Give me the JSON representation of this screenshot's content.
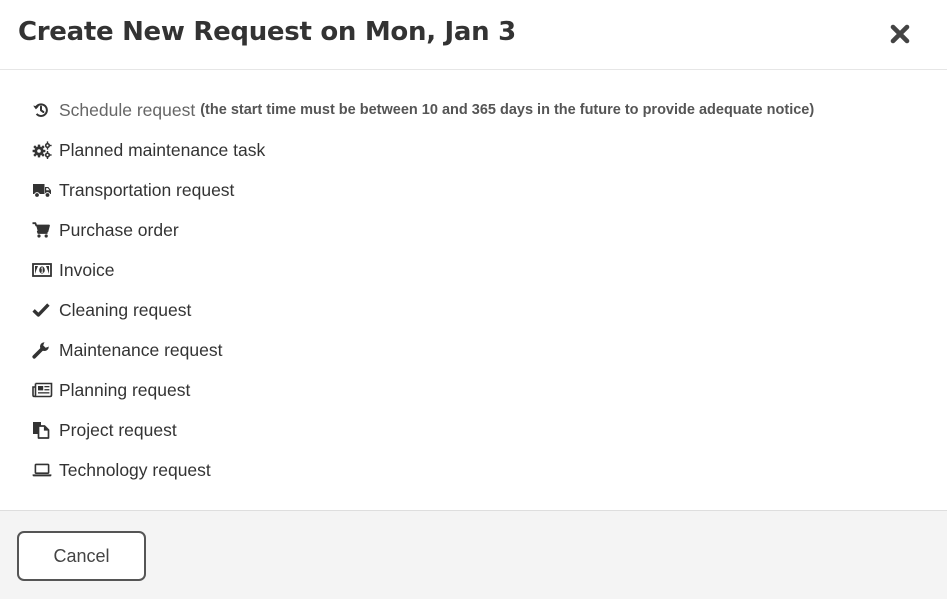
{
  "dialog": {
    "title": "Create New Request on Mon, Jan 3",
    "close_icon": "close-icon"
  },
  "requests": [
    {
      "label": "Schedule request",
      "note": "(the start time must be between 10 and 365 days in the future to provide adequate notice)",
      "icon": "history-icon",
      "disabled": true
    },
    {
      "label": "Planned maintenance task",
      "icon": "gears-icon"
    },
    {
      "label": "Transportation request",
      "icon": "truck-icon"
    },
    {
      "label": "Purchase order",
      "icon": "shopping-cart-icon"
    },
    {
      "label": "Invoice",
      "icon": "money-bill-icon"
    },
    {
      "label": "Cleaning request",
      "icon": "checkmark-icon"
    },
    {
      "label": "Maintenance request",
      "icon": "wrench-icon"
    },
    {
      "label": "Planning request",
      "icon": "newspaper-icon"
    },
    {
      "label": "Project request",
      "icon": "documents-icon"
    },
    {
      "label": "Technology request",
      "icon": "laptop-icon"
    }
  ],
  "footer": {
    "cancel_label": "Cancel"
  },
  "colors": {
    "text": "#333333",
    "footer_bg": "#f4f4f4",
    "button_border": "#555555"
  }
}
